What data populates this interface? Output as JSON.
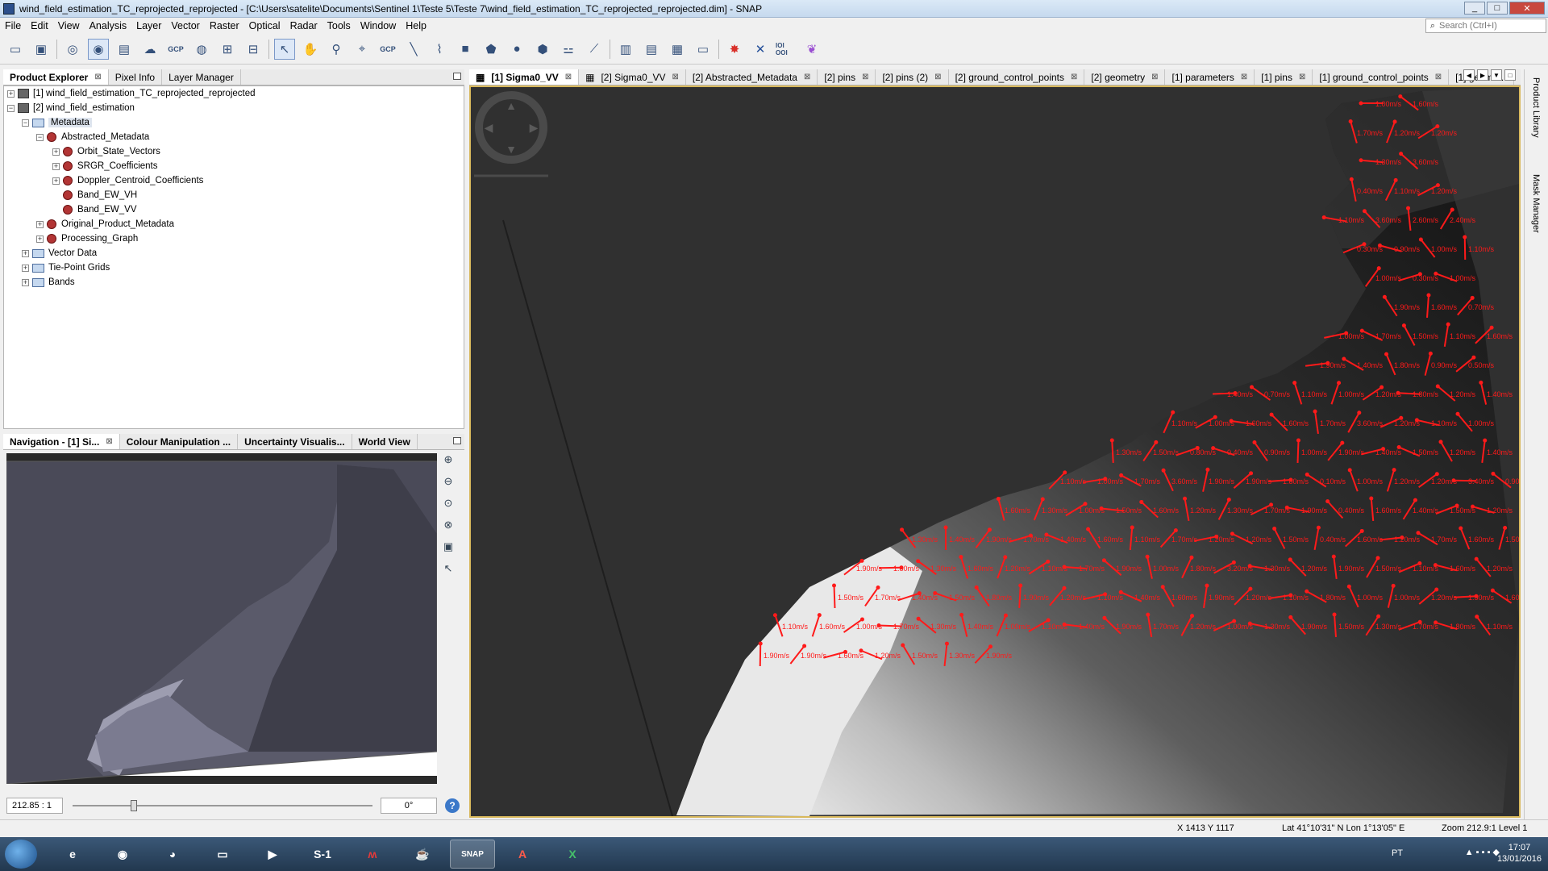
{
  "window": {
    "title": "wind_field_estimation_TC_reprojected_reprojected - [C:\\Users\\satelite\\Documents\\Sentinel 1\\Teste 5\\Teste 7\\wind_field_estimation_TC_reprojected_reprojected.dim] - SNAP",
    "controls": {
      "minimize": "_",
      "maximize": "□",
      "close": "✕"
    }
  },
  "menu": [
    "File",
    "Edit",
    "View",
    "Analysis",
    "Layer",
    "Vector",
    "Raster",
    "Optical",
    "Radar",
    "Tools",
    "Window",
    "Help"
  ],
  "search": {
    "placeholder": "Search (Ctrl+I)"
  },
  "toolbar": {
    "icons": [
      "open-product-icon",
      "save-product-icon",
      "pin-tool-icon",
      "view-tool-icon",
      "layer-icon",
      "cloud-icon",
      "gcp-icon",
      "globe-icon",
      "graph-icon",
      "batch-icon",
      "select-tool-icon",
      "pan-tool-icon",
      "zoom-tool-icon",
      "zoom-pin-icon",
      "gcp-tool-icon",
      "line-tool-icon",
      "polyline-tool-icon",
      "rectangle-tool-icon",
      "polygon-tool-icon",
      "ellipse-tool-icon",
      "range-tool-icon",
      "magic-wand-icon",
      "ruler-icon",
      "tile-horizontal-icon",
      "tile-vertical-icon",
      "tile-grid-icon",
      "folder-icon",
      "star-icon",
      "spectrum-icon",
      "binary-icon",
      "butterfly-icon"
    ],
    "gcp_label": "GCP",
    "bits_label": "IOI OOI"
  },
  "left_panel": {
    "tabs": [
      "Product Explorer",
      "Pixel Info",
      "Layer Manager"
    ],
    "tree": [
      {
        "label": "[1] wind_field_estimation_TC_reprojected_reprojected",
        "level": 0,
        "icon": "product",
        "expander": "+"
      },
      {
        "label": "[2] wind_field_estimation",
        "level": 0,
        "icon": "product",
        "expander": "−"
      },
      {
        "label": "Metadata",
        "level": 1,
        "icon": "folder",
        "expander": "−",
        "selected": true
      },
      {
        "label": "Abstracted_Metadata",
        "level": 2,
        "icon": "meta",
        "expander": "−"
      },
      {
        "label": "Orbit_State_Vectors",
        "level": 3,
        "icon": "meta",
        "expander": "+"
      },
      {
        "label": "SRGR_Coefficients",
        "level": 3,
        "icon": "meta",
        "expander": "+"
      },
      {
        "label": "Doppler_Centroid_Coefficients",
        "level": 3,
        "icon": "meta",
        "expander": "+"
      },
      {
        "label": "Band_EW_VH",
        "level": 3,
        "icon": "meta",
        "expander": ""
      },
      {
        "label": "Band_EW_VV",
        "level": 3,
        "icon": "meta",
        "expander": ""
      },
      {
        "label": "Original_Product_Metadata",
        "level": 2,
        "icon": "meta",
        "expander": "+"
      },
      {
        "label": "Processing_Graph",
        "level": 2,
        "icon": "meta",
        "expander": "+"
      },
      {
        "label": "Vector Data",
        "level": 1,
        "icon": "folder",
        "expander": "+"
      },
      {
        "label": "Tie-Point Grids",
        "level": 1,
        "icon": "folder",
        "expander": "+"
      },
      {
        "label": "Bands",
        "level": 1,
        "icon": "folder",
        "expander": "+"
      }
    ]
  },
  "nav_panel": {
    "tabs": [
      "Navigation - [1] Si...",
      "Colour Manipulation ...",
      "Uncertainty Visualis...",
      "World View"
    ],
    "zoom": "212.85 : 1",
    "angle": "0°",
    "help": "?"
  },
  "doc_tabs": [
    "[1] Sigma0_VV",
    "[2] Sigma0_VV",
    "[2] Abstracted_Metadata",
    "[2] pins",
    "[2] pins (2)",
    "[2] ground_control_points",
    "[2] geometry",
    "[1] parameters",
    "[1] pins",
    "[1] ground_control_points",
    "[1] geome..."
  ],
  "wind_labels": [
    "1.00m/s",
    "1.60m/s",
    "1.70m/s",
    "1.20m/s",
    "1.20m/s",
    "1.30m/s",
    "3.60m/s",
    "0.40m/s",
    "1.10m/s",
    "1.20m/s",
    "1.10m/s",
    "3.60m/s",
    "2.60m/s",
    "2.40m/s",
    "0.30m/s",
    "0.90m/s",
    "1.00m/s",
    "1.10m/s",
    "1.00m/s",
    "0.30m/s",
    "1.00m/s",
    "1.90m/s",
    "1.60m/s",
    "0.70m/s",
    "1.00m/s",
    "1.70m/s",
    "1.50m/s",
    "1.10m/s",
    "1.60m/s",
    "1.90m/s",
    "1.40m/s",
    "1.80m/s",
    "0.90m/s",
    "0.50m/s",
    "1.40m/s",
    "0.70m/s",
    "1.10m/s",
    "1.00m/s",
    "1.20m/s",
    "1.80m/s",
    "1.20m/s",
    "1.40m/s",
    "1.10m/s",
    "1.00m/s",
    "1.60m/s",
    "1.60m/s",
    "1.70m/s",
    "3.60m/s",
    "1.20m/s",
    "1.10m/s",
    "1.00m/s",
    "1.30m/s",
    "1.50m/s",
    "0.80m/s",
    "0.40m/s",
    "0.90m/s",
    "1.00m/s",
    "1.90m/s",
    "1.40m/s",
    "1.50m/s",
    "1.20m/s",
    "1.40m/s",
    "1.10m/s",
    "1.00m/s",
    "1.70m/s",
    "3.60m/s",
    "1.90m/s",
    "1.90m/s",
    "1.80m/s",
    "0.10m/s",
    "1.00m/s",
    "1.20m/s",
    "1.20m/s",
    "3.40m/s",
    "0.90m/s",
    "1.60m/s",
    "1.30m/s",
    "1.00m/s",
    "1.50m/s",
    "1.60m/s",
    "1.20m/s",
    "1.30m/s",
    "1.70m/s",
    "1.90m/s",
    "0.40m/s",
    "1.60m/s",
    "1.40m/s",
    "1.50m/s",
    "1.20m/s",
    "1.30m/s",
    "1.40m/s",
    "1.90m/s",
    "1.70m/s",
    "1.40m/s",
    "1.60m/s",
    "1.10m/s",
    "1.70m/s",
    "1.20m/s",
    "1.20m/s",
    "1.50m/s",
    "0.40m/s",
    "1.60m/s",
    "1.20m/s",
    "1.70m/s",
    "1.60m/s",
    "1.50m/s",
    "1.90m/s",
    "1.80m/s",
    "1.30m/s",
    "1.60m/s",
    "1.20m/s",
    "1.10m/s",
    "1.70m/s",
    "1.90m/s",
    "1.00m/s",
    "1.80m/s",
    "3.20m/s",
    "1.30m/s",
    "1.20m/s",
    "1.90m/s",
    "1.50m/s",
    "1.10m/s",
    "1.60m/s",
    "1.20m/s",
    "1.50m/s",
    "1.70m/s",
    "1.40m/s",
    "1.50m/s",
    "1.80m/s",
    "1.90m/s",
    "1.20m/s",
    "1.10m/s",
    "1.40m/s",
    "1.60m/s",
    "1.90m/s",
    "1.20m/s",
    "1.10m/s",
    "1.80m/s",
    "1.00m/s",
    "1.00m/s",
    "1.20m/s",
    "1.50m/s",
    "1.60m/s",
    "1.10m/s",
    "1.60m/s",
    "1.00m/s",
    "1.70m/s",
    "1.30m/s",
    "1.40m/s",
    "1.00m/s",
    "1.10m/s",
    "1.40m/s",
    "1.90m/s",
    "1.70m/s",
    "1.20m/s",
    "1.00m/s",
    "1.30m/s",
    "1.90m/s",
    "1.50m/s",
    "1.30m/s",
    "1.70m/s",
    "1.80m/s",
    "1.10m/s",
    "1.90m/s",
    "1.90m/s",
    "1.60m/s",
    "1.20m/s",
    "1.50m/s",
    "1.30m/s",
    "1.90m/s"
  ],
  "status": {
    "xy": "X   1413  Y   1117",
    "latlon": "Lat 41°10'31\" N  Lon 1°13'05\" E",
    "zoom": "Zoom 212.9:1  Level 1"
  },
  "right_strip": [
    "Product Library",
    "Mask Manager"
  ],
  "taskbar": {
    "apps": [
      "internet-explorer-icon",
      "chrome-icon",
      "firefox-icon",
      "explorer-icon",
      "media-player-icon",
      "snap-s1-icon",
      "mendeley-icon",
      "java-icon",
      "snap-icon",
      "acrobat-icon",
      "excel-icon"
    ],
    "s1_label": "S-1",
    "snap_label": "SNAP",
    "lang": "PT",
    "time": "17:07",
    "date": "13/01/2016"
  },
  "colors": {
    "accent_frame": "#d8b85c",
    "arrow": "#ff1a1a",
    "viewer_bg": "#303030"
  }
}
